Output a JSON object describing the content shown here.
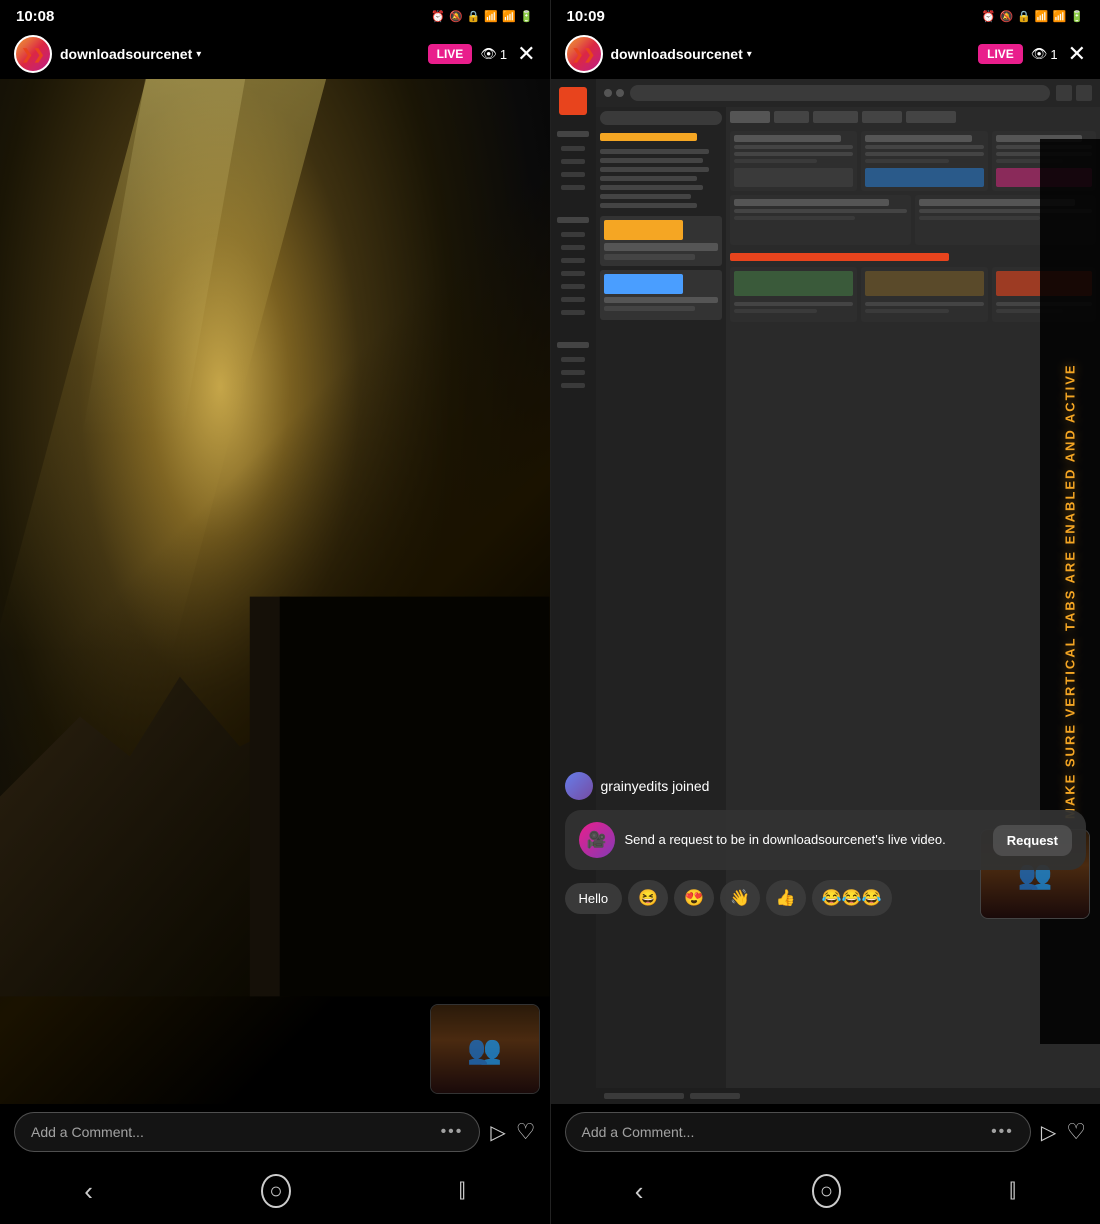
{
  "left": {
    "status": {
      "time": "10:08",
      "icons": "⏰🔕🔒📶📶🔋"
    },
    "header": {
      "username": "downloadsourcenet",
      "live_label": "LIVE",
      "viewer_icon": "👁",
      "viewer_count": "1",
      "close_label": "✕"
    },
    "bottom": {
      "comment_placeholder": "Add a Comment...",
      "dots": "•••",
      "send_icon": "▷",
      "heart_icon": "♡"
    },
    "nav": {
      "back": "‹",
      "home": "○",
      "menu": "⫿"
    }
  },
  "right": {
    "status": {
      "time": "10:09",
      "icons": "⏰🔕🔒📶📶🔋"
    },
    "header": {
      "username": "downloadsourcenet",
      "live_label": "LIVE",
      "viewer_icon": "👁",
      "viewer_count": "1",
      "close_label": "✕"
    },
    "overlay_text": "MAKE SURE VERTICAL TABS ARE ENABLED AND ACTIVE",
    "comment_joined": {
      "text": "grainyedits joined"
    },
    "request_banner": {
      "text": "Send a request to be in downloadsourcenet's live video.",
      "button": "Request"
    },
    "reactions": [
      {
        "type": "pill",
        "label": "Hello"
      },
      {
        "type": "emoji",
        "label": "😆"
      },
      {
        "type": "emoji",
        "label": "😍"
      },
      {
        "type": "emoji",
        "label": "👋"
      },
      {
        "type": "emoji",
        "label": "👍"
      },
      {
        "type": "emoji",
        "label": "😂😂😂"
      }
    ],
    "bottom": {
      "comment_placeholder": "Add a Comment...",
      "dots": "•••",
      "send_icon": "▷",
      "heart_icon": "♡"
    },
    "nav": {
      "back": "‹",
      "home": "○",
      "menu": "⫿"
    }
  }
}
